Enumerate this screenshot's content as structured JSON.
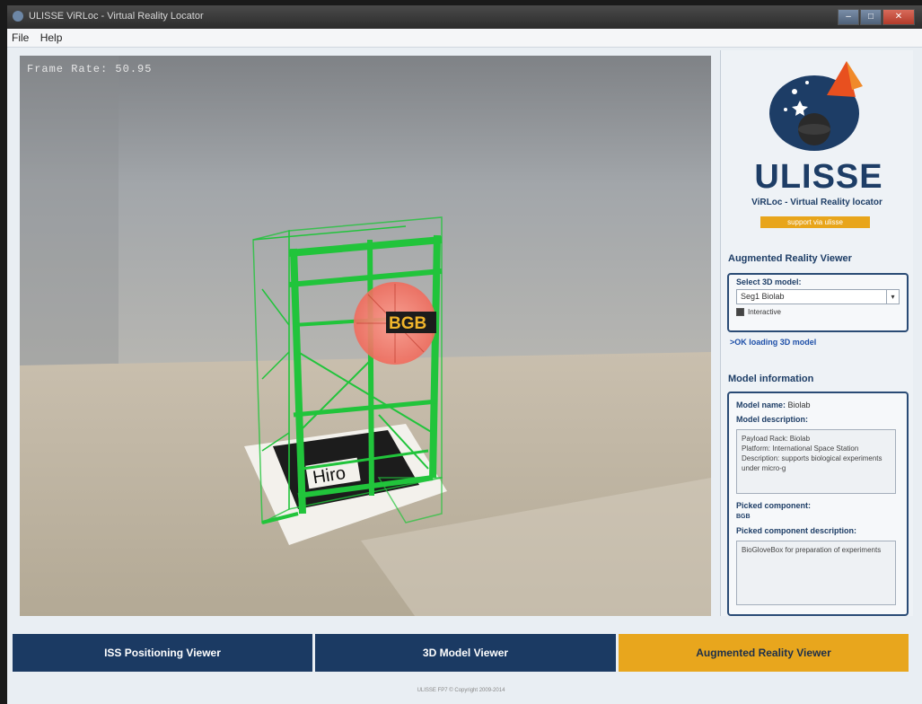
{
  "window": {
    "title": "ULISSE ViRLoc - Virtual Reality Locator"
  },
  "menu": {
    "items": [
      "File",
      "Help"
    ]
  },
  "viewport": {
    "frame_rate": "Frame Rate: 50.95",
    "component_label": "BGB",
    "marker_label": "Hiro"
  },
  "logo": {
    "title": "ULISSE",
    "subtitle": "ViRLoc - Virtual Reality locator",
    "support": "support via ulisse"
  },
  "ar_viewer": {
    "section_title": "Augmented Reality Viewer",
    "select_label": "Select 3D model:",
    "selected_model": "Seg1 Biolab",
    "interactive_label": "Interactive",
    "status": ">OK loading 3D model"
  },
  "model_info": {
    "section_title": "Model information",
    "name_label": "Model name:",
    "name_value": "Biolab",
    "description_label": "Model description:",
    "description": "Payload Rack: Biolab\nPlatform: International Space Station\nDescription: supports biological experiments under micro-g",
    "picked_label": "Picked component:",
    "picked_value": "BGB",
    "picked_desc_label": "Picked component description:",
    "picked_desc": "BioGloveBox for preparation of experiments"
  },
  "tabs": [
    {
      "label": "ISS Positioning Viewer"
    },
    {
      "label": "3D Model Viewer"
    },
    {
      "label": "Augmented Reality Viewer"
    }
  ],
  "footer": "ULISSE FP7 © Copyright 2009-2014"
}
